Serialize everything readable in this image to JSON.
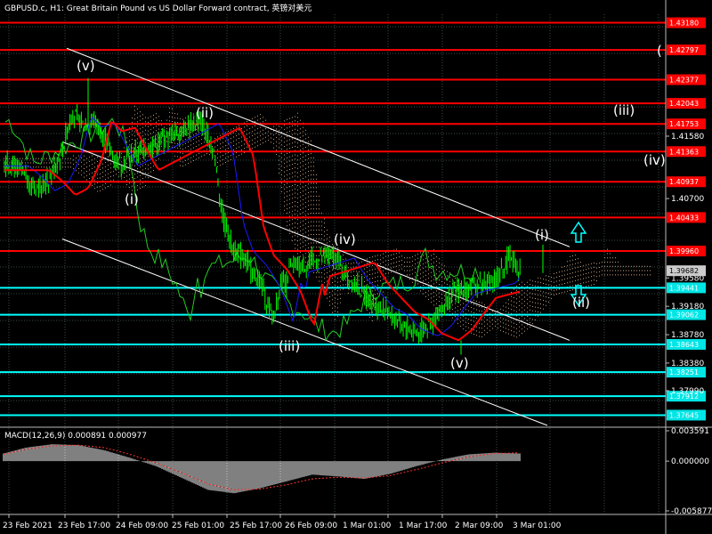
{
  "header": {
    "title": "GBPUSD.c, H1:  Great Britain Pound vs US Dollar Forward contract, 英镑对美元"
  },
  "colors": {
    "background": "#000000",
    "grid": "#3a4a4a",
    "candles": "#00ff00",
    "level_red": "#ff0000",
    "level_cyan": "#00ffff",
    "channel": "#ffffff",
    "ma_red": "#ff0000",
    "ma_blue": "#1a1aff",
    "lagging_line": "#22cc22",
    "cloud": "#c8a080",
    "macd_hist": "#ffffff",
    "macd_signal": "#ff3333"
  },
  "chart_data": [
    {
      "type": "candlestick",
      "symbol": "GBPUSD.c",
      "timeframe": "H1",
      "ylim": [
        1.375,
        1.433
      ],
      "x_labels": [
        "23 Feb 2021",
        "23 Feb 17:00",
        "24 Feb 09:00",
        "25 Feb 01:00",
        "25 Feb 17:00",
        "26 Feb 09:00",
        "1 Mar 01:00",
        "1 Mar 17:00",
        "2 Mar 09:00",
        "3 Mar 01:00"
      ],
      "y_ticks": [
        "1.41580",
        "1.40700",
        "1.39580",
        "1.39180",
        "1.38780",
        "1.38380",
        "1.37990"
      ],
      "price_label": "1.39682",
      "levels": [
        {
          "value": "1.43180",
          "color": "red"
        },
        {
          "value": "1.42797",
          "color": "red"
        },
        {
          "value": "1.42377",
          "color": "red"
        },
        {
          "value": "1.42043",
          "color": "red"
        },
        {
          "value": "1.41753",
          "color": "red"
        },
        {
          "value": "1.41363",
          "color": "red"
        },
        {
          "value": "1.40937",
          "color": "red"
        },
        {
          "value": "1.40433",
          "color": "red"
        },
        {
          "value": "1.39960",
          "color": "red"
        },
        {
          "value": "1.39441",
          "color": "cyan"
        },
        {
          "value": "1.39062",
          "color": "cyan"
        },
        {
          "value": "1.38643",
          "color": "cyan"
        },
        {
          "value": "1.38251",
          "color": "cyan"
        },
        {
          "value": "1.37912",
          "color": "cyan"
        },
        {
          "value": "1.37645",
          "color": "cyan"
        }
      ],
      "wave_labels": [
        "(v)",
        "(ii)",
        "(i)",
        "(iii)",
        "(iv)",
        "(v)",
        "(i)",
        "(ii)",
        "(iii)",
        "(iv)",
        "("
      ],
      "close_path": [
        [
          "23 Feb 00:00",
          1.412
        ],
        [
          "23 Feb 04:00",
          1.4105
        ],
        [
          "23 Feb 08:00",
          1.4085
        ],
        [
          "23 Feb 12:00",
          1.4095
        ],
        [
          "23 Feb 16:00",
          1.4135
        ],
        [
          "23 Feb 19:00",
          1.419
        ],
        [
          "23 Feb 22:00",
          1.4175
        ],
        [
          "24 Feb 02:00",
          1.418
        ],
        [
          "24 Feb 06:00",
          1.4145
        ],
        [
          "24 Feb 09:00",
          1.412
        ],
        [
          "24 Feb 13:00",
          1.413
        ],
        [
          "24 Feb 17:00",
          1.414
        ],
        [
          "24 Feb 21:00",
          1.415
        ],
        [
          "25 Feb 01:00",
          1.416
        ],
        [
          "25 Feb 05:00",
          1.417
        ],
        [
          "25 Feb 09:00",
          1.418
        ],
        [
          "25 Feb 13:00",
          1.414
        ],
        [
          "25 Feb 16:00",
          1.404
        ],
        [
          "25 Feb 19:00",
          1.4
        ],
        [
          "25 Feb 23:00",
          1.398
        ],
        [
          "26 Feb 03:00",
          1.395
        ],
        [
          "26 Feb 07:00",
          1.39
        ],
        [
          "26 Feb 11:00",
          1.396
        ],
        [
          "26 Feb 15:00",
          1.394
        ],
        [
          "26 Feb 19:00",
          1.397
        ],
        [
          "1 Mar 01:00",
          1.399
        ],
        [
          "1 Mar 05:00",
          1.396
        ],
        [
          "1 Mar 09:00",
          1.394
        ],
        [
          "1 Mar 13:00",
          1.392
        ],
        [
          "1 Mar 17:00",
          1.391
        ],
        [
          "1 Mar 21:00",
          1.389
        ],
        [
          "2 Mar 02:00",
          1.388
        ],
        [
          "2 Mar 06:00",
          1.3895
        ],
        [
          "2 Mar 09:00",
          1.3915
        ],
        [
          "2 Mar 13:00",
          1.394
        ],
        [
          "2 Mar 17:00",
          1.3945
        ],
        [
          "2 Mar 21:00",
          1.395
        ],
        [
          "3 Mar 01:00",
          1.3955
        ],
        [
          "3 Mar 05:00",
          1.399
        ],
        [
          "3 Mar 08:00",
          1.3968
        ]
      ],
      "wave_tops": [
        "(v) 1.4240",
        "(ii) 1.4195",
        "(iv) 1.3990",
        "(i) 1.4005"
      ],
      "wave_bottoms": [
        "(iii) 1.3880",
        "(v) 1.3858"
      ]
    },
    {
      "type": "histogram",
      "indicator": "MACD",
      "label": "MACD(12,26,9) 0.000891 0.000977",
      "y_ticks": [
        "0.003591",
        "0.000000",
        "-0.005877"
      ],
      "ylim": [
        -0.005877,
        0.003591
      ],
      "histogram_samples": [
        0.0008,
        0.0016,
        0.002,
        0.0019,
        0.0013,
        0.0004,
        -0.0006,
        -0.002,
        -0.0034,
        -0.0038,
        -0.0032,
        -0.0024,
        -0.0016,
        -0.0018,
        -0.0021,
        -0.0015,
        -0.0006,
        0.0002,
        0.0008,
        0.001,
        0.0009
      ],
      "signal_samples": [
        0.0007,
        0.0014,
        0.0018,
        0.0019,
        0.0016,
        0.0008,
        -0.0002,
        -0.0014,
        -0.0027,
        -0.0034,
        -0.0033,
        -0.0028,
        -0.0021,
        -0.0019,
        -0.002,
        -0.0017,
        -0.001,
        -0.0002,
        0.0005,
        0.0009,
        0.001
      ]
    }
  ]
}
